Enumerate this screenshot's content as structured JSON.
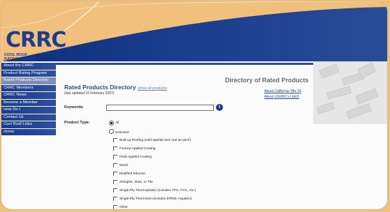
{
  "logo": {
    "main": "CRRC",
    "sub_line1": "COOL ROOF",
    "sub_line2": "RATING COUNCIL"
  },
  "sidebar": {
    "items": [
      {
        "label": "About the CRRC"
      },
      {
        "label": "Product Rating Program"
      },
      {
        "label": "Rated Products Directory"
      },
      {
        "label": "CRRC Members"
      },
      {
        "label": "CRRC News"
      },
      {
        "label": "Become a Member"
      },
      {
        "label": "How Do I"
      },
      {
        "label": "Contact Us"
      },
      {
        "label": "Cool Roof Links"
      },
      {
        "label": "Home"
      }
    ]
  },
  "main": {
    "title": "Rated Products Directory",
    "show_all": "(show all products)",
    "updated": "(last updated 15 February 2007)",
    "directory_title": "Directory of Rated Products",
    "link1": "About California Title 24",
    "link2": "About USGBC's LEED",
    "keyword_label": "Keywords:",
    "keyword_value": "",
    "product_type_label": "Product Type:",
    "radio_all": "All",
    "radio_selected": "Selected:",
    "options": [
      "Built-up Roofing (mild asphalt and coal tar pitch)",
      "Factory-Applied Coating",
      "Field-Applied Coating",
      "Metal",
      "Modified Bitumen",
      "Shingles, Slate, or Tile",
      "Single-Ply Thermoplastic (includes TPO, PVC, etc.)",
      "Single-Ply Thermoset (includes EPDM, Hypalon)",
      "Other"
    ]
  },
  "colors": {
    "brand_blue": "#1f3d8c",
    "frame_orange": "#f0c07c"
  }
}
